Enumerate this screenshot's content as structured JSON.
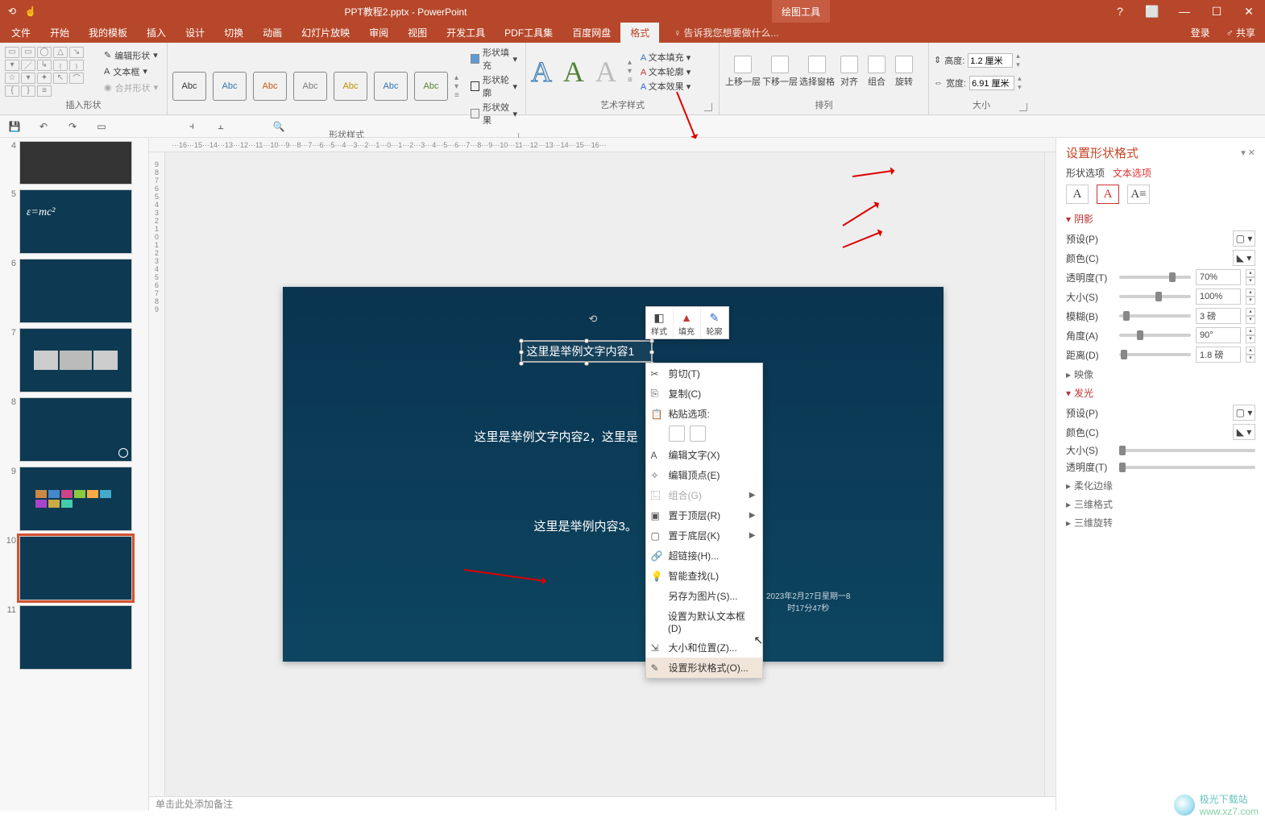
{
  "app": {
    "title": "PPT教程2.pptx - PowerPoint",
    "drawing_tools_tag": "绘图工具"
  },
  "window_buttons": {
    "help": "?",
    "ribbon_opts": "⬜",
    "minimize": "—",
    "maximize": "☐",
    "close": "✕"
  },
  "tabs": {
    "file": "文件",
    "home": "开始",
    "my_templates": "我的模板",
    "insert": "插入",
    "design": "设计",
    "transition": "切换",
    "animation": "动画",
    "slideshow": "幻灯片放映",
    "review": "审阅",
    "view": "视图",
    "developer": "开发工具",
    "pdf": "PDF工具集",
    "baidu": "百度网盘",
    "format": "格式"
  },
  "tell_me": "♀ 告诉我您想要做什么...",
  "account": {
    "login": "登录",
    "share": "共享"
  },
  "ribbon": {
    "group_insert_shapes": "插入形状",
    "edit_shape": "编辑形状",
    "text_box": "文本框",
    "merge_shape": "合并形状",
    "group_shape_styles": "形状样式",
    "shape_fill": "形状填充",
    "shape_outline": "形状轮廓",
    "shape_effects": "形状效果",
    "style_chip": "Abc",
    "group_wordart": "艺术字样式",
    "text_fill": "文本填充",
    "text_outline": "文本轮廓",
    "text_effects": "文本效果",
    "group_arrange": "排列",
    "bring_fwd": "上移一层",
    "send_back": "下移一层",
    "sel_pane": "选择窗格",
    "align": "对齐",
    "group_btn": "组合",
    "rotate": "旋转",
    "group_size": "大小",
    "height_label": "高度:",
    "width_label": "宽度:",
    "height_val": "1.2 厘米",
    "width_val": "6.91 厘米"
  },
  "ruler_h_text": "···16···15···14···13···12···11···10···9···8···7···6···5···4···3···2···1···0···1···2···3···4···5···6···7···8···9···10···11···12···13···14···15···16···",
  "ruler_v": [
    "9",
    "8",
    "7",
    "6",
    "5",
    "4",
    "3",
    "2",
    "1",
    "0",
    "1",
    "2",
    "3",
    "4",
    "5",
    "6",
    "7",
    "8",
    "9"
  ],
  "slides_nums": [
    "4",
    "5",
    "6",
    "7",
    "8",
    "9",
    "10",
    "11"
  ],
  "slide": {
    "text1": "这里是举例文字内容1",
    "text2": "这里是举例文字内容2，这里是",
    "text3": "这里是举例内容3。",
    "date_line1": "2023年2月27日星期一8",
    "date_line2": "时17分47秒"
  },
  "mini_tb": {
    "style": "样式",
    "fill": "填充",
    "outline": "轮廓"
  },
  "context_menu": {
    "cut": "剪切(T)",
    "copy": "复制(C)",
    "paste_opts": "粘贴选项:",
    "edit_text": "编辑文字(X)",
    "edit_points": "编辑顶点(E)",
    "group": "组合(G)",
    "bring_front": "置于顶层(R)",
    "send_back": "置于底层(K)",
    "link": "超链接(H)...",
    "smart_lookup": "智能查找(L)",
    "save_pic": "另存为图片(S)...",
    "default_tb": "设置为默认文本框(D)",
    "size_pos": "大小和位置(Z)...",
    "format_shape": "设置形状格式(O)..."
  },
  "notes_placeholder": "单击此处添加备注",
  "format_pane": {
    "title": "设置形状格式",
    "shape_opts": "形状选项",
    "text_opts": "文本选项",
    "shadow": "阴影",
    "preset": "预设(P)",
    "color": "颜色(C)",
    "transparency": "透明度(T)",
    "size": "大小(S)",
    "blur": "模糊(B)",
    "angle": "角度(A)",
    "distance": "距离(D)",
    "reflection": "映像",
    "glow": "发光",
    "soft_edges": "柔化边缘",
    "format_3d": "三维格式",
    "rotate_3d": "三维旋转",
    "val_transparency": "70%",
    "val_size": "100%",
    "val_blur": "3 磅",
    "val_angle": "90°",
    "val_distance": "1.8 磅"
  },
  "watermark": {
    "name": "极光下载站",
    "url": "www.xz7.com"
  }
}
